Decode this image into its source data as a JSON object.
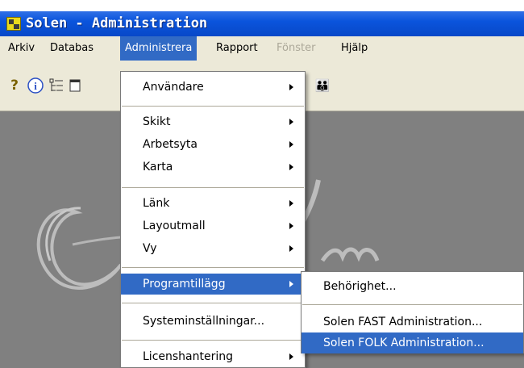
{
  "window": {
    "title": "Solen - Administration"
  },
  "menubar": [
    {
      "label": "Arkiv"
    },
    {
      "label": "Databas"
    },
    {
      "label": "Administrera"
    },
    {
      "label": "Rapport"
    },
    {
      "label": "Fönster"
    },
    {
      "label": "Hjälp"
    }
  ],
  "toolbar": {
    "help_glyph": "?",
    "info_glyph": "i",
    "people_glyph": "👪"
  },
  "administrera_menu": [
    {
      "label": "Användare"
    },
    {
      "label": "Skikt"
    },
    {
      "label": "Arbetsyta"
    },
    {
      "label": "Karta"
    },
    {
      "label": "Länk"
    },
    {
      "label": "Layoutmall"
    },
    {
      "label": "Vy"
    },
    {
      "label": "Programtillägg"
    },
    {
      "label": "Systeminställningar..."
    },
    {
      "label": "Licenshantering"
    }
  ],
  "programtillagg_submenu": [
    {
      "label": "Behörighet..."
    },
    {
      "label": "Solen FAST Administration..."
    },
    {
      "label": "Solen FOLK Administration..."
    }
  ],
  "colors": {
    "titlebar": "#0a54dc",
    "highlight": "#316ac5",
    "menu_bg": "#ece9d8",
    "workspace": "#808080"
  }
}
